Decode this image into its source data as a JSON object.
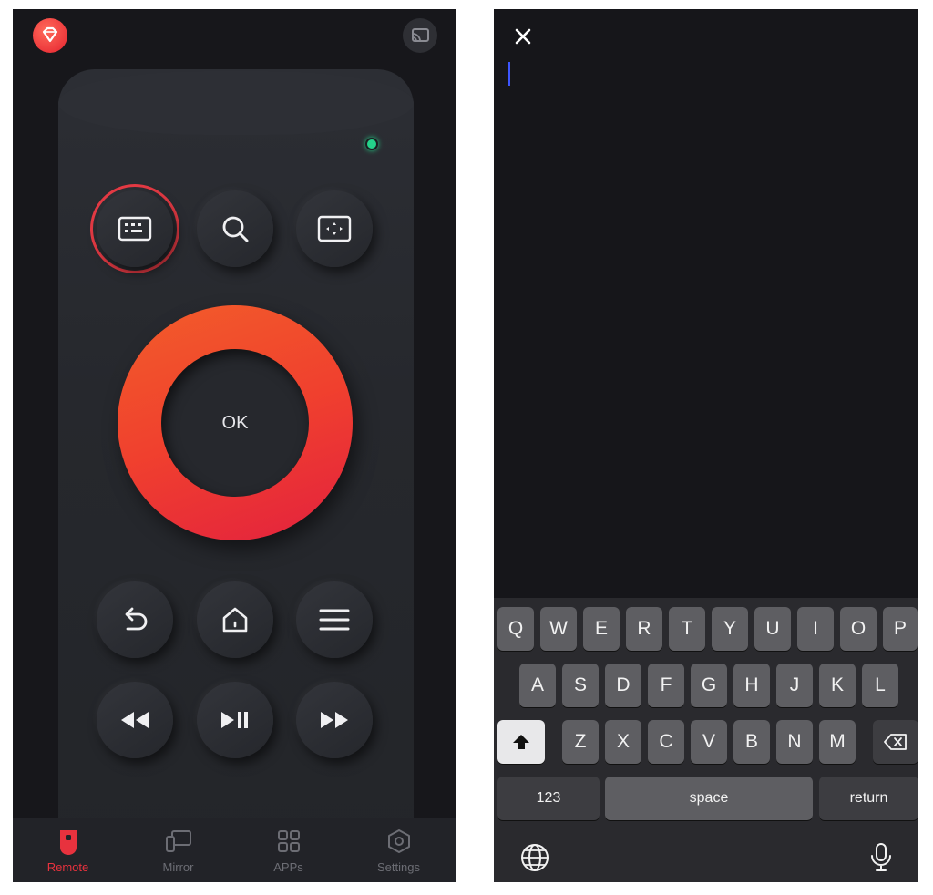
{
  "remote": {
    "ok_label": "OK",
    "accent_color": "#e8323e",
    "status_led_color": "#24d38a",
    "top_buttons": [
      "keyboard-icon",
      "search-icon",
      "screen-fit-icon"
    ],
    "nav_buttons": [
      "back-icon",
      "home-icon",
      "menu-icon"
    ],
    "media_buttons": [
      "rewind-icon",
      "play-pause-icon",
      "fast-forward-icon"
    ]
  },
  "bottom_nav": {
    "items": [
      {
        "label": "Remote",
        "icon": "remote-icon",
        "active": true
      },
      {
        "label": "Mirror",
        "icon": "mirror-icon",
        "active": false
      },
      {
        "label": "APPs",
        "icon": "apps-icon",
        "active": false
      },
      {
        "label": "Settings",
        "icon": "settings-icon",
        "active": false
      }
    ]
  },
  "keyboard": {
    "row1": [
      "Q",
      "W",
      "E",
      "R",
      "T",
      "Y",
      "U",
      "I",
      "O",
      "P"
    ],
    "row2": [
      "A",
      "S",
      "D",
      "F",
      "G",
      "H",
      "J",
      "K",
      "L"
    ],
    "row3": [
      "Z",
      "X",
      "C",
      "V",
      "B",
      "N",
      "M"
    ],
    "numbers_label": "123",
    "space_label": "space",
    "return_label": "return"
  }
}
